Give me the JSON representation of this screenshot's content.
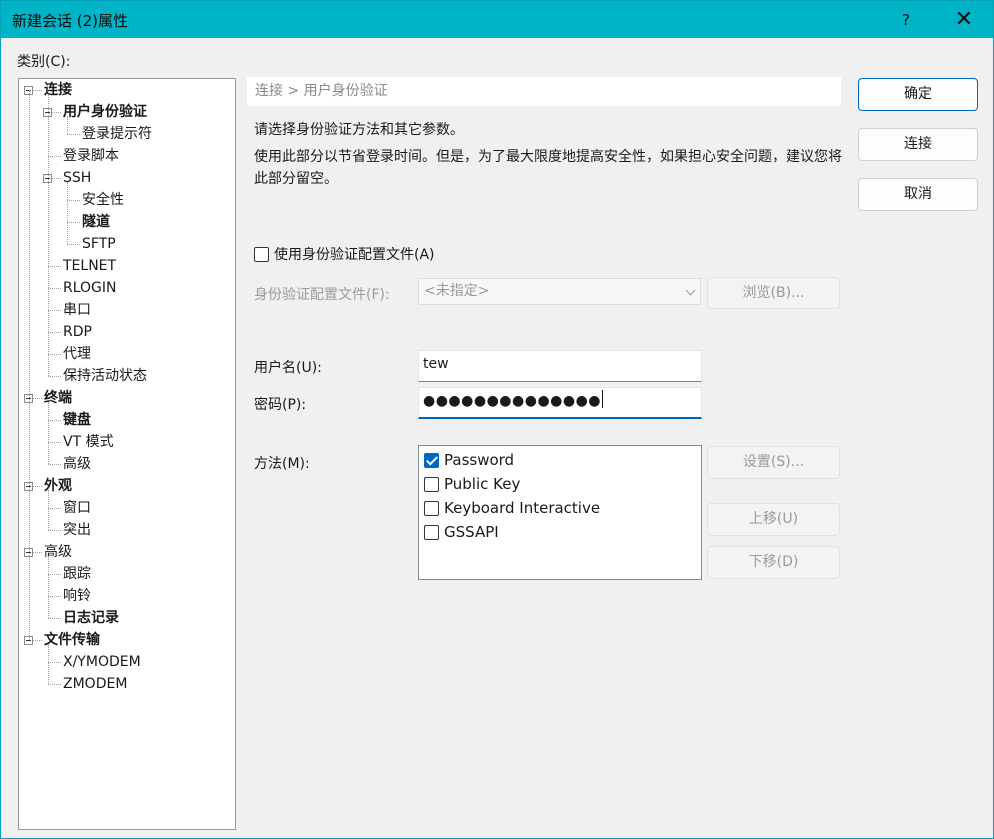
{
  "window": {
    "title": "新建会话 (2)属性",
    "help_label": "?",
    "close_label": "✕"
  },
  "category_label": "类别(C):",
  "tree": [
    {
      "label": "连接",
      "bold": true,
      "level": 0,
      "toggle": true
    },
    {
      "label": "用户身份验证",
      "bold": true,
      "level": 1,
      "toggle": true
    },
    {
      "label": "登录提示符",
      "bold": false,
      "level": 2,
      "toggle": false
    },
    {
      "label": "登录脚本",
      "bold": false,
      "level": 1,
      "toggle": false
    },
    {
      "label": "SSH",
      "bold": false,
      "level": 1,
      "toggle": true
    },
    {
      "label": "安全性",
      "bold": false,
      "level": 2,
      "toggle": false
    },
    {
      "label": "隧道",
      "bold": true,
      "level": 2,
      "toggle": false
    },
    {
      "label": "SFTP",
      "bold": false,
      "level": 2,
      "toggle": false
    },
    {
      "label": "TELNET",
      "bold": false,
      "level": 1,
      "toggle": false
    },
    {
      "label": "RLOGIN",
      "bold": false,
      "level": 1,
      "toggle": false
    },
    {
      "label": "串口",
      "bold": false,
      "level": 1,
      "toggle": false
    },
    {
      "label": "RDP",
      "bold": false,
      "level": 1,
      "toggle": false
    },
    {
      "label": "代理",
      "bold": false,
      "level": 1,
      "toggle": false
    },
    {
      "label": "保持活动状态",
      "bold": false,
      "level": 1,
      "toggle": false
    },
    {
      "label": "终端",
      "bold": true,
      "level": 0,
      "toggle": true
    },
    {
      "label": "键盘",
      "bold": true,
      "level": 1,
      "toggle": false
    },
    {
      "label": "VT 模式",
      "bold": false,
      "level": 1,
      "toggle": false
    },
    {
      "label": "高级",
      "bold": false,
      "level": 1,
      "toggle": false
    },
    {
      "label": "外观",
      "bold": true,
      "level": 0,
      "toggle": true
    },
    {
      "label": "窗口",
      "bold": false,
      "level": 1,
      "toggle": false
    },
    {
      "label": "突出",
      "bold": false,
      "level": 1,
      "toggle": false
    },
    {
      "label": "高级",
      "bold": false,
      "level": 0,
      "toggle": true
    },
    {
      "label": "跟踪",
      "bold": false,
      "level": 1,
      "toggle": false
    },
    {
      "label": "响铃",
      "bold": false,
      "level": 1,
      "toggle": false
    },
    {
      "label": "日志记录",
      "bold": true,
      "level": 1,
      "toggle": false
    },
    {
      "label": "文件传输",
      "bold": true,
      "level": 0,
      "toggle": true
    },
    {
      "label": "X/YMODEM",
      "bold": false,
      "level": 1,
      "toggle": false
    },
    {
      "label": "ZMODEM",
      "bold": false,
      "level": 1,
      "toggle": false
    }
  ],
  "breadcrumb": "连接 > 用户身份验证",
  "description_1": "请选择身份验证方法和其它参数。",
  "description_2": "使用此部分以节省登录时间。但是，为了最大限度地提高安全性，如果担心安全问题，建议您将此部分留空。",
  "auth_profile": {
    "checkbox_label": "使用身份验证配置文件(A)",
    "checked": false,
    "file_label": "身份验证配置文件(F):",
    "select_value": "<未指定>",
    "browse_label": "浏览(B)..."
  },
  "credentials": {
    "username_label": "用户名(U):",
    "username_value": "tew",
    "password_label": "密码(P):",
    "password_mask": "●●●●●●●●●●●●●●"
  },
  "methods": {
    "label": "方法(M):",
    "items": [
      {
        "label": "Password",
        "checked": true
      },
      {
        "label": "Public Key",
        "checked": false
      },
      {
        "label": "Keyboard Interactive",
        "checked": false
      },
      {
        "label": "GSSAPI",
        "checked": false
      }
    ],
    "settings_label": "设置(S)...",
    "up_label": "上移(U)",
    "down_label": "下移(D)"
  },
  "dialog_buttons": {
    "ok_label": "确定",
    "connect_label": "连接",
    "cancel_label": "取消"
  },
  "colors": {
    "titlebar": "#00b4c8",
    "accent": "#0067c0"
  }
}
